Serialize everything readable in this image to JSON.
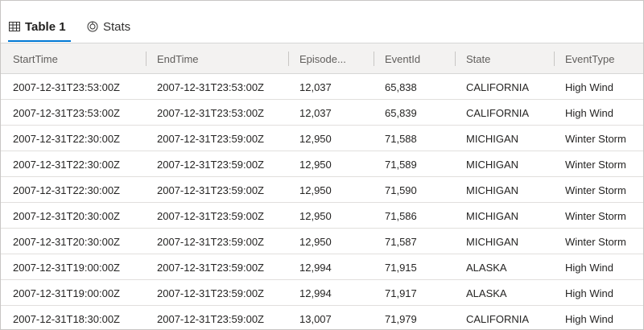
{
  "tabs": {
    "table_label": "Table 1",
    "stats_label": "Stats"
  },
  "table": {
    "columns": [
      "StartTime",
      "EndTime",
      "Episode...",
      "EventId",
      "State",
      "EventType"
    ],
    "rows": [
      [
        "2007-12-31T23:53:00Z",
        "2007-12-31T23:53:00Z",
        "12,037",
        "65,838",
        "CALIFORNIA",
        "High Wind"
      ],
      [
        "2007-12-31T23:53:00Z",
        "2007-12-31T23:53:00Z",
        "12,037",
        "65,839",
        "CALIFORNIA",
        "High Wind"
      ],
      [
        "2007-12-31T22:30:00Z",
        "2007-12-31T23:59:00Z",
        "12,950",
        "71,588",
        "MICHIGAN",
        "Winter Storm"
      ],
      [
        "2007-12-31T22:30:00Z",
        "2007-12-31T23:59:00Z",
        "12,950",
        "71,589",
        "MICHIGAN",
        "Winter Storm"
      ],
      [
        "2007-12-31T22:30:00Z",
        "2007-12-31T23:59:00Z",
        "12,950",
        "71,590",
        "MICHIGAN",
        "Winter Storm"
      ],
      [
        "2007-12-31T20:30:00Z",
        "2007-12-31T23:59:00Z",
        "12,950",
        "71,586",
        "MICHIGAN",
        "Winter Storm"
      ],
      [
        "2007-12-31T20:30:00Z",
        "2007-12-31T23:59:00Z",
        "12,950",
        "71,587",
        "MICHIGAN",
        "Winter Storm"
      ],
      [
        "2007-12-31T19:00:00Z",
        "2007-12-31T23:59:00Z",
        "12,994",
        "71,915",
        "ALASKA",
        "High Wind"
      ],
      [
        "2007-12-31T19:00:00Z",
        "2007-12-31T23:59:00Z",
        "12,994",
        "71,917",
        "ALASKA",
        "High Wind"
      ],
      [
        "2007-12-31T18:30:00Z",
        "2007-12-31T23:59:00Z",
        "13,007",
        "71,979",
        "CALIFORNIA",
        "High Wind"
      ]
    ]
  },
  "colors": {
    "accent": "#0078d4",
    "header_bg": "#f3f2f1"
  },
  "icons": {
    "table_tab": "table-grid-icon",
    "stats_tab": "stats-icon"
  }
}
